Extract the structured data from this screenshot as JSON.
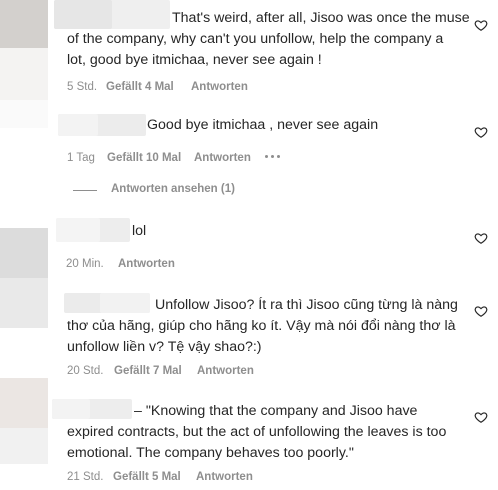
{
  "comments": [
    {
      "lines": [
        "That's weird, after all, Jisoo was once the muse",
        "of the company, why can't you unfollow, help the company a",
        "lot, good bye itmichaa, never see again !"
      ],
      "time": "5 Std.",
      "likes": "Gefällt 4 Mal",
      "reply": "Antworten"
    },
    {
      "lines": [
        "Good bye itmichaa , never see again"
      ],
      "time": "1 Tag",
      "likes": "Gefällt 10 Mal",
      "reply": "Antworten",
      "more_icon": "more-options-icon",
      "view_replies": "Antworten ansehen (1)"
    },
    {
      "lines": [
        "lol"
      ],
      "time": "20 Min.",
      "reply": "Antworten"
    },
    {
      "lines": [
        "Unfollow Jisoo? Ít ra thì Jisoo cũng từng là nàng",
        "thơ của hãng, giúp cho hãng ko ít. Vậy mà nói đổi nàng thơ là",
        "unfollow liền v? Tệ vậy shao?:)"
      ],
      "time": "20 Std.",
      "likes": "Gefällt 7 Mal",
      "reply": "Antworten"
    },
    {
      "lines": [
        "– \"Knowing that the company and Jisoo have",
        "expired contracts, but the act of unfollowing the leaves is too",
        "emotional. The company behaves too poorly.\""
      ],
      "time": "21 Std.",
      "likes": "Gefällt 5 Mal",
      "reply": "Antworten"
    }
  ],
  "icons": {
    "like": "heart-icon"
  },
  "colors": {
    "text": "#262626",
    "secondary": "#8e8e8e",
    "blur": "#ececec"
  }
}
